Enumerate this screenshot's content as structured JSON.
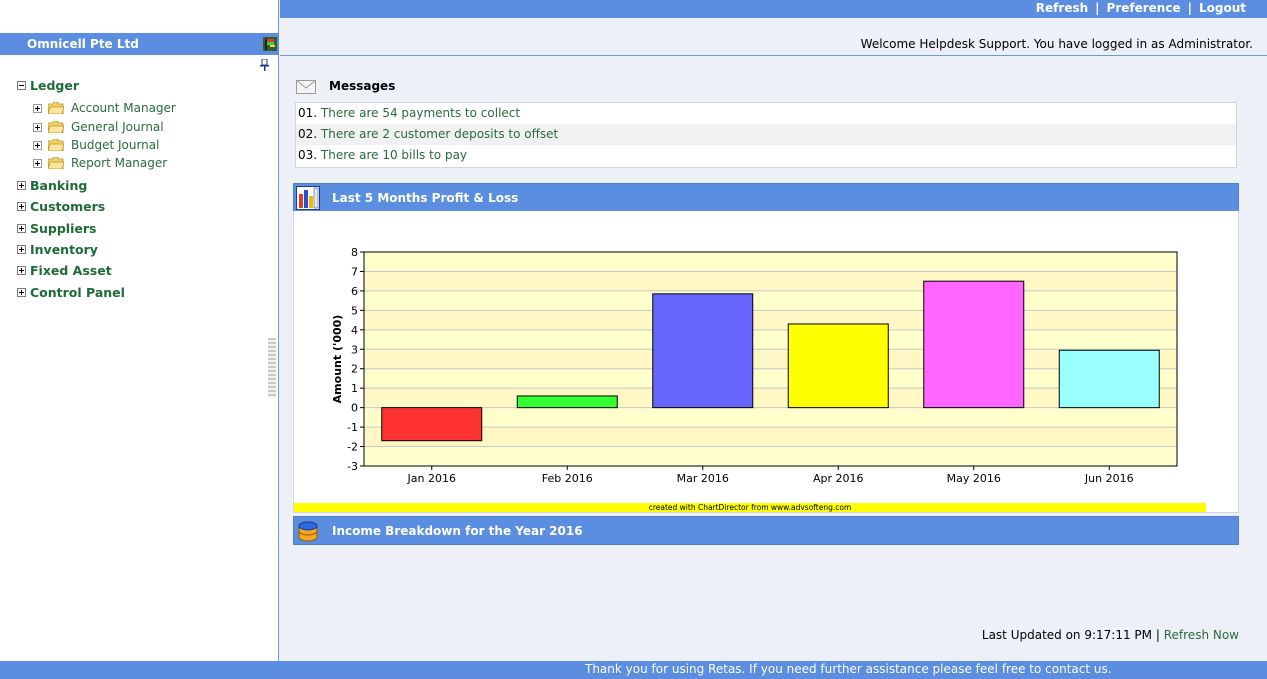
{
  "topbar": {
    "refresh": "Refresh",
    "preference": "Preference",
    "logout": "Logout",
    "separator": "|"
  },
  "welcome": "Welcome Helpdesk Support. You have logged in as Administrator.",
  "sidebar": {
    "company": "Omnicell Pte Ltd",
    "ledger": {
      "label": "Ledger",
      "children": [
        "Account Manager",
        "General Journal",
        "Budget Journal",
        "Report Manager"
      ]
    },
    "roots": [
      "Banking",
      "Customers",
      "Suppliers",
      "Inventory",
      "Fixed Asset",
      "Control Panel"
    ]
  },
  "messages": {
    "title": "Messages",
    "items": [
      {
        "num": "01.",
        "text": "There are 54 payments to collect"
      },
      {
        "num": "02.",
        "text": "There are 2 customer deposits to offset"
      },
      {
        "num": "03.",
        "text": "There are 10 bills to pay"
      }
    ]
  },
  "profit_panel": {
    "title": "Last 5 Months Profit & Loss"
  },
  "income_panel": {
    "title": "Income Breakdown for the Year 2016"
  },
  "chart_data": {
    "type": "bar",
    "categories": [
      "Jan 2016",
      "Feb 2016",
      "Mar 2016",
      "Apr 2016",
      "May 2016",
      "Jun 2016"
    ],
    "values": [
      -1.7,
      0.6,
      5.85,
      4.3,
      6.5,
      2.95
    ],
    "colors": [
      "#ff3333",
      "#33ff33",
      "#6666ff",
      "#ffff00",
      "#ff66ff",
      "#99ffff"
    ],
    "ylabel": "Amount ('000)",
    "xlabel": "",
    "ylim": [
      -3,
      8
    ],
    "yticks": [
      -3,
      -2,
      -1,
      0,
      1,
      2,
      3,
      4,
      5,
      6,
      7,
      8
    ],
    "grid": true,
    "plot_background": "#ffffcc"
  },
  "chart_credit": "created with ChartDirector from www.advsofteng.com",
  "last_updated": {
    "prefix": "Last Updated on 9:17:11 PM",
    "separator": "|",
    "link": "Refresh Now"
  },
  "footer": "Thank you for using Retas. If you need further assistance please feel free to contact us."
}
